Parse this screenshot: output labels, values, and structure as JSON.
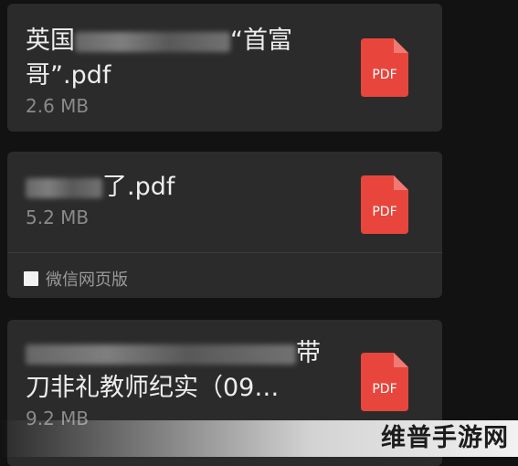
{
  "files": [
    {
      "name_prefix": "英国",
      "name_suffix": "“首富\n哥”.pdf",
      "size": "2.6 MB",
      "icon": "pdf-file-icon",
      "icon_label": "PDF"
    },
    {
      "name_prefix": "",
      "name_suffix": "了.pdf",
      "size": "5.2 MB",
      "icon": "pdf-file-icon",
      "icon_label": "PDF",
      "source": "微信网页版"
    },
    {
      "name_prefix": "",
      "name_suffix": "带\n刀非礼教师纪实（09…",
      "size": "9.2 MB",
      "icon": "pdf-file-icon",
      "icon_label": "PDF"
    }
  ],
  "watermark": "维普手游网",
  "colors": {
    "background": "#121212",
    "card": "#2b2b2b",
    "pdf_red": "#e8453c"
  }
}
